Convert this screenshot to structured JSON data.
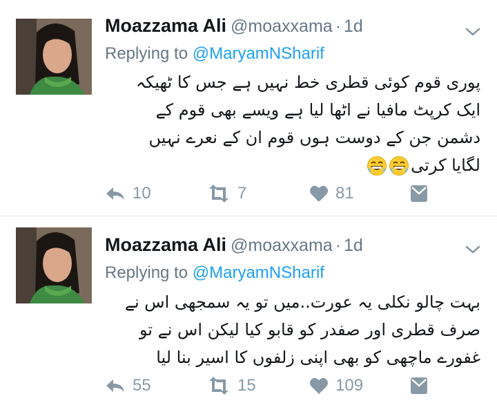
{
  "tweets": [
    {
      "author_name": "Moazzama Ali",
      "handle": "@moaxxama",
      "time": "1d",
      "replying_label": "Replying to",
      "replying_to": "@MaryamNSharif",
      "text_lines": [
        "پوری قوم کوئی قطری خط نہیں ہے جس کا ٹھیکہ",
        "ایک کرپٹ مافیا نے اٹھا لیا ہے ویسے بھی قوم کے",
        "دشمن جن کے دوست ہوں قوم ان کے نعرے نہیں",
        "لگایا کرتی"
      ],
      "emoji": [
        "grinning-face-icon",
        "grinning-face-icon"
      ],
      "replies": "10",
      "retweets": "7",
      "likes": "81"
    },
    {
      "author_name": "Moazzama Ali",
      "handle": "@moaxxama",
      "time": "1d",
      "replying_label": "Replying to",
      "replying_to": "@MaryamNSharif",
      "text_lines": [
        "بہت چالو نکلی یہ عورت..میں تو یہ سمجھی اس نے",
        "صرف قطری اور صفدر کو قابو کیا لیکن اس نے تو",
        "غفورے ماچھی کو بھی اپنی زلفوں کا اسیر بنا لیا"
      ],
      "replies": "55",
      "retweets": "15",
      "likes": "109"
    }
  ],
  "colors": {
    "text": "#14171a",
    "secondary": "#657786",
    "mention": "#1da1f2",
    "action": "#8899a6",
    "divider": "#e1e8ed"
  }
}
